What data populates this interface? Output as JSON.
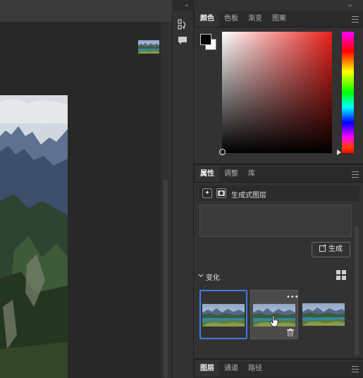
{
  "panels": {
    "color": {
      "tabs": [
        "颜色",
        "色板",
        "渐变",
        "图案"
      ],
      "active_tab": 0,
      "foreground": "#000000",
      "background": "#ffffff",
      "hue": "#e8201c"
    },
    "properties": {
      "tabs": [
        "属性",
        "调整",
        "库"
      ],
      "active_tab": 0,
      "layer_type": "生成式图层",
      "prompt_value": "",
      "generate_button": "生成",
      "variations_label": "变化"
    },
    "layers": {
      "tabs": [
        "图层",
        "通道",
        "路径"
      ],
      "active_tab": 0
    }
  },
  "variations": {
    "count": 3,
    "selected_index": 0,
    "hover_index": 1,
    "more_label": "•••"
  },
  "colors": {
    "accent": "#3e7be0",
    "panel_bg": "#323232",
    "canvas_bg": "#282828"
  },
  "icons": [
    "collapse-arrows-icon",
    "history-icon",
    "comment-icon",
    "panel-menu-icon",
    "sparkle-icon",
    "mask-icon",
    "generate-icon",
    "chevron-down-icon",
    "grid-view-icon",
    "more-icon",
    "trash-icon",
    "pointer-cursor-icon"
  ]
}
